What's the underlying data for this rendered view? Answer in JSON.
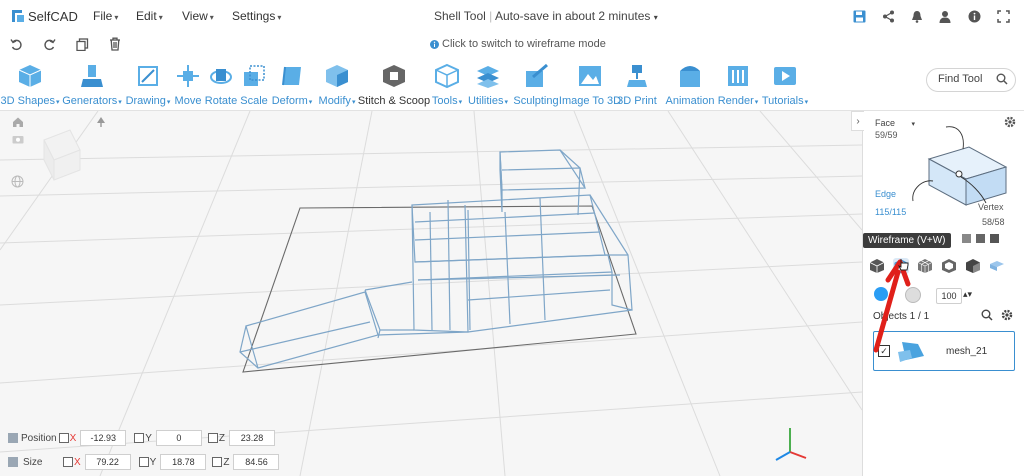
{
  "app": {
    "name": "SelfCAD"
  },
  "menu": {
    "file": "File",
    "edit": "Edit",
    "view": "View",
    "settings": "Settings"
  },
  "title": {
    "project": "Shell Tool",
    "autosave": "Auto-save in about 2 minutes"
  },
  "hint": "Click to switch to wireframe mode",
  "tools": [
    {
      "label": "3D Shapes",
      "caret": true
    },
    {
      "label": "Generators",
      "caret": true
    },
    {
      "label": "Drawing",
      "caret": true
    },
    {
      "label": "Move",
      "caret": false
    },
    {
      "label": "Rotate",
      "caret": false
    },
    {
      "label": "Scale",
      "caret": false
    },
    {
      "label": "Deform",
      "caret": true
    },
    {
      "label": "Modify",
      "caret": true
    },
    {
      "label": "Stitch & Scoop",
      "caret": false
    },
    {
      "label": "Tools",
      "caret": true
    },
    {
      "label": "Utilities",
      "caret": true
    },
    {
      "label": "Sculpting",
      "caret": false
    },
    {
      "label": "Image To 3D",
      "caret": false
    },
    {
      "label": "3D Print",
      "caret": false
    },
    {
      "label": "Animation",
      "caret": false
    },
    {
      "label": "Render",
      "caret": true
    },
    {
      "label": "Tutorials",
      "caret": true
    }
  ],
  "search": {
    "placeholder": "Find Tool"
  },
  "panel": {
    "face_label": "Face",
    "face_count": "59/59",
    "edge_label": "Edge",
    "edge_count": "115/115",
    "vertex_label": "Vertex",
    "vertex_count": "58/58",
    "tooltip": "Wireframe (V+W)",
    "opacity": "100",
    "objects_label": "Objects 1 / 1",
    "object_name": "mesh_21"
  },
  "position": {
    "label": "Position",
    "x": "-12.93",
    "y": "0",
    "z": "23.28"
  },
  "size": {
    "label": "Size",
    "x": "79.22",
    "y": "18.78",
    "z": "84.56"
  },
  "axes": {
    "x": "X",
    "y": "Y",
    "z": "Z"
  },
  "colors": {
    "accent": "#3a8fd0",
    "tool_icon": "#5aaee6",
    "wire": "#7fa6c8",
    "arrow": "#e0201a"
  }
}
